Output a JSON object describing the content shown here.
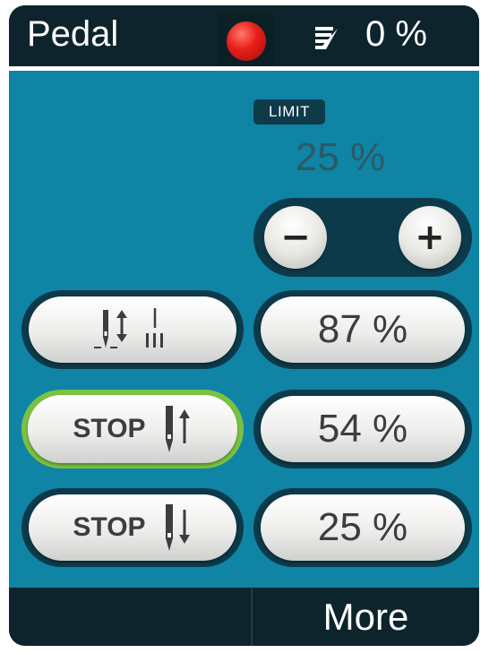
{
  "header": {
    "title": "Pedal",
    "record_indicator": {
      "icon": "record-dot-icon",
      "color": "#e8201a"
    },
    "bobbin_icon": "bobbin-thread-icon",
    "bobbin_value": "0 %"
  },
  "limit": {
    "badge_label": "LIMIT",
    "value": "25 %",
    "decrease_label": "−",
    "increase_label": "+"
  },
  "controls": {
    "needle_mode_icon": "needle-up-down-icon",
    "stop_up_label": "STOP",
    "stop_up_icon": "needle-stop-up-icon",
    "stop_down_label": "STOP",
    "stop_down_icon": "needle-stop-down-icon",
    "value_1": "87 %",
    "value_2": "54 %",
    "value_3": "25 %",
    "selected_highlight_color": "#7bc242"
  },
  "footer": {
    "right_label": "More"
  },
  "colors": {
    "panel": "#0f84a4",
    "bar": "#0d242c"
  }
}
